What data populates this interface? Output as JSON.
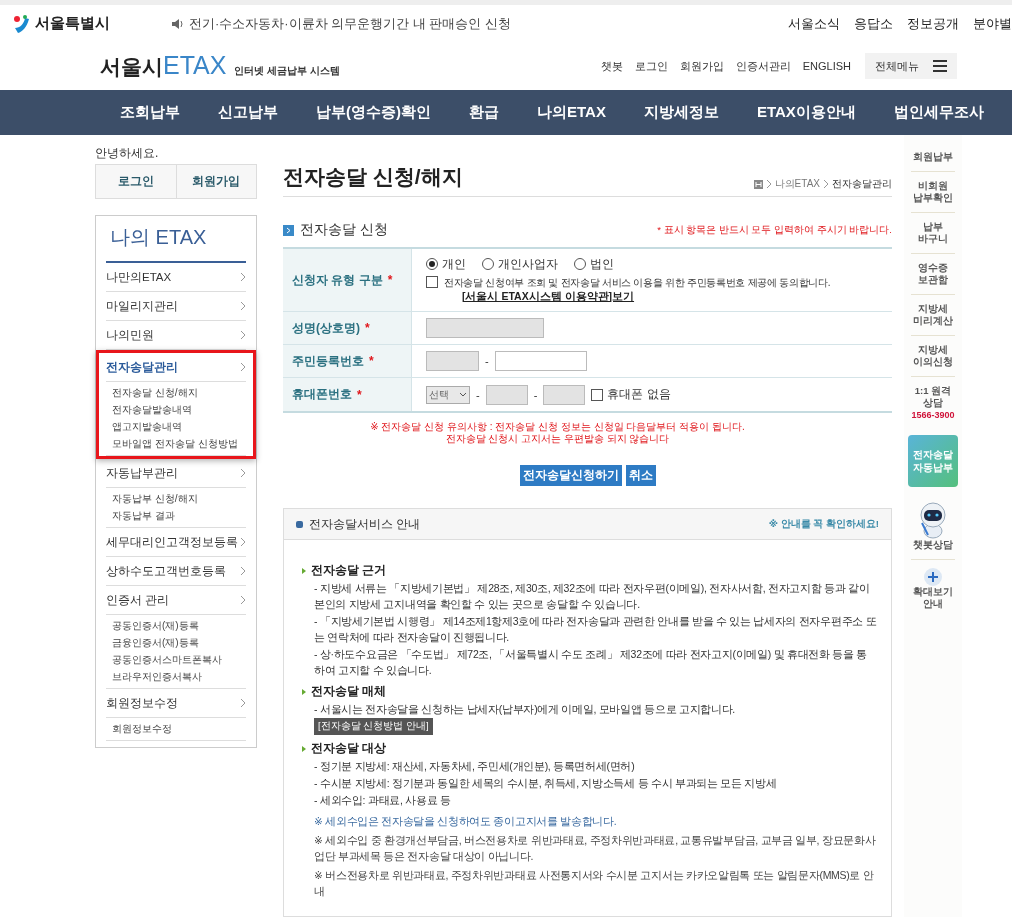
{
  "top_bar": {
    "logo": "서울특별시",
    "notice": "전기·수소자동차·이륜차 의무운행기간 내 판매승인 신청",
    "links": [
      "서울소식",
      "응답소",
      "정보공개",
      "분야별"
    ]
  },
  "header": {
    "brand_prefix": "서울시",
    "brand": "ETAX",
    "tagline": "인터넷 세금납부 시스템",
    "links": [
      "챗봇",
      "로그인",
      "회원가입",
      "인증서관리",
      "ENGLISH"
    ],
    "menu_button": "전체메뉴"
  },
  "nav": [
    "조회납부",
    "신고납부",
    "납부(영수증)확인",
    "환급",
    "나의ETAX",
    "지방세정보",
    "ETAX이용안내",
    "법인세무조사"
  ],
  "left": {
    "greeting": "안녕하세요.",
    "buttons": [
      "로그인",
      "회원가입"
    ],
    "title": "나의 ETAX",
    "groups": [
      {
        "label": "나만의ETAX",
        "selected": false,
        "highlighted": false
      },
      {
        "label": "마일리지관리",
        "selected": false,
        "highlighted": false
      },
      {
        "label": "나의민원",
        "selected": false,
        "highlighted": false
      },
      {
        "label": "전자송달관리",
        "selected": true,
        "highlighted": true,
        "children": [
          "전자송달 신청/해지",
          "전자송달발송내역",
          "앱고지발송내역",
          "모바일앱 전자송달 신청방법"
        ]
      },
      {
        "label": "자동납부관리",
        "selected": false,
        "highlighted": false,
        "children": [
          "자동납부 신청/해지",
          "자동납부 결과"
        ]
      },
      {
        "label": "세무대리인고객정보등록",
        "selected": false,
        "highlighted": false
      },
      {
        "label": "상하수도고객번호등록",
        "selected": false,
        "highlighted": false
      },
      {
        "label": "인증서 관리",
        "selected": false,
        "highlighted": false,
        "children": [
          "공동인증서(재)등록",
          "금융인증서(재)등록",
          "공동인증서스마트폰복사",
          "브라우저인증서복사"
        ]
      },
      {
        "label": "회원정보수정",
        "selected": false,
        "highlighted": false,
        "children": [
          "회원정보수정"
        ]
      }
    ]
  },
  "main": {
    "title": "전자송달 신청/해지",
    "breadcrumb": [
      "나의ETAX",
      "전자송달관리"
    ],
    "form": {
      "heading": "전자송달 신청",
      "required_symbol": "*",
      "required_note": "* 표시 항목은 반드시 모두 입력하여 주시기 바랍니다.",
      "rows": [
        {
          "kind": "applicant_type",
          "label": "신청자 유형 구분",
          "required": true,
          "radios": [
            {
              "label": "개인",
              "selected": true
            },
            {
              "label": "개인사업자",
              "selected": false
            },
            {
              "label": "법인",
              "selected": false
            }
          ],
          "consent": {
            "checked": false,
            "text": "전자송달 신청여부 조회 및 전자송달 서비스 이용을 위한 주민등록번호 제공에 동의합니다.",
            "link": "[서울시 ETAX시스템 이용약관]보기"
          }
        },
        {
          "kind": "name",
          "label": "성명(상호명)",
          "required": true,
          "field": {
            "disabled": true
          }
        },
        {
          "kind": "rrn",
          "label": "주민등록번호",
          "required": true,
          "fields": [
            {
              "disabled": true
            },
            {
              "disabled": false
            }
          ],
          "separator": "-"
        },
        {
          "kind": "phone",
          "label": "휴대폰번호",
          "required": true,
          "select": "선택",
          "fields": [
            {
              "disabled": true
            },
            {
              "disabled": true
            }
          ],
          "separators": [
            "-",
            "-"
          ],
          "no_phone": {
            "label": "휴대폰 없음",
            "checked": false
          }
        }
      ],
      "warnings": [
        "※ 전자송달 신청 유의사항 : 전자송달 신청 정보는 신청일 다음달부터 적용이 됩니다.",
        "전자송달 신청시 고지서는 우편발송 되지 않습니다"
      ],
      "buttons": [
        "전자송달신청하기",
        "취소"
      ]
    },
    "info": {
      "title": "전자송달서비스 안내",
      "note": "※ 안내를 꼭 확인하세요!",
      "sections": [
        {
          "heading": "전자송달 근거",
          "items": [
            {
              "kind": "text",
              "text": "- 지방세 서류는 「지방세기본법」 제28조, 제30조, 제32조에 따라 전자우편(이메일), 전자사서함, 전자고지함 등과 같이 본인의 지방세 고지내역을 확인할 수 있는 곳으로 송달할 수 있습니다."
            },
            {
              "kind": "text",
              "text": "- 「지방세기본법 시행령」 제14조제1항제3호에 따라 전자송달과 관련한 안내를 받을 수 있는 납세자의 전자우편주소 또는 연락처에 따라 전자송달이 진행됩니다."
            },
            {
              "kind": "text",
              "text": "- 상·하도수요금은 「수도법」 제72조, 「서울특별시 수도 조례」 제32조에 따라 전자고지(이메일) 및 휴대전화 등을 통하여 고지할 수 있습니다."
            }
          ]
        },
        {
          "heading": "전자송달 매체",
          "items": [
            {
              "kind": "text",
              "text": "- 서울시는 전자송달을 신청하는 납세자(납부자)에게 이메일, 모바일앱 등으로 고지합니다."
            },
            {
              "kind": "button",
              "text": "[전자송달 신청방법 안내]"
            }
          ]
        },
        {
          "heading": "전자송달 대상",
          "items": [
            {
              "kind": "text",
              "text": "- 정기분 지방세: 재산세, 자동차세, 주민세(개인분), 등록면허세(면허)"
            },
            {
              "kind": "text",
              "text": "- 수시분 지방세: 정기분과 동일한 세목의 수시분, 취득세, 지방소득세 등 수시 부과되는 모든 지방세"
            },
            {
              "kind": "text",
              "text": "- 세외수입: 과태료, 사용료 등"
            },
            {
              "kind": "highlight",
              "text": "※ 세외수입은 전자송달을 신청하여도 종이고지서를 발송합니다."
            },
            {
              "kind": "note",
              "text": "※ 세외수입 중 환경개선부담금, 버스전용차로 위반과태료, 주정차위반과태료, 교통유발부담금, 교부금 일부, 장묘문화사업단 부과세목 등은 전자송달 대상이 아닙니다."
            },
            {
              "kind": "note",
              "text": "※ 버스전용차로 위반과태료, 주정차위반과태료 사전통지서와 수시분 고지서는 카카오알림톡 또는 알림문자(MMS)로 안내"
            }
          ]
        }
      ]
    }
  },
  "right_bar": [
    {
      "kind": "link",
      "lines": [
        "회원납부"
      ]
    },
    {
      "kind": "link",
      "lines": [
        "비회원",
        "납부확인"
      ]
    },
    {
      "kind": "link",
      "lines": [
        "납부",
        "바구니"
      ]
    },
    {
      "kind": "link",
      "lines": [
        "영수증",
        "보관함"
      ]
    },
    {
      "kind": "link",
      "lines": [
        "지방세",
        "미리계산"
      ]
    },
    {
      "kind": "link",
      "lines": [
        "지방세",
        "이의신청"
      ]
    },
    {
      "kind": "consult",
      "lines": [
        "1:1 원격",
        "상담"
      ],
      "phone": "1566-3900"
    },
    {
      "kind": "banner",
      "lines": [
        "전자송달",
        "자동납부"
      ]
    },
    {
      "kind": "chatbot",
      "lines": [
        "챗봇상담"
      ]
    },
    {
      "kind": "zoom",
      "lines": [
        "확대보기",
        "안내"
      ]
    }
  ]
}
